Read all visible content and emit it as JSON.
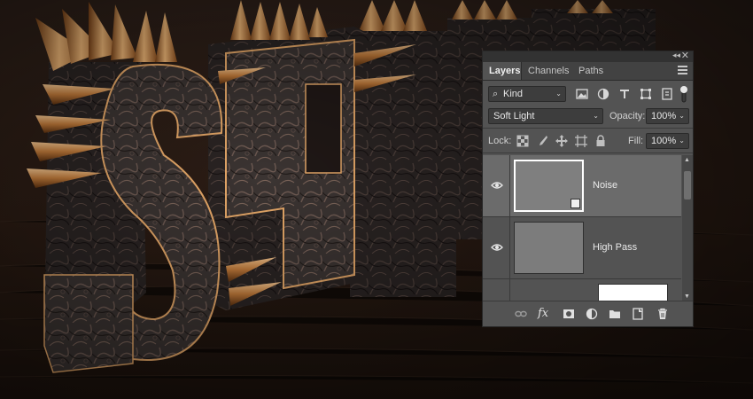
{
  "panel": {
    "tabs": [
      {
        "label": "Layers",
        "active": true
      },
      {
        "label": "Channels",
        "active": false
      },
      {
        "label": "Paths",
        "active": false
      }
    ],
    "collapse_glyph": "◂◂",
    "close_glyph": "✕",
    "filter": {
      "kind_label": "Kind",
      "icons": [
        "image-filter-icon",
        "adjustment-filter-icon",
        "type-filter-icon",
        "shape-filter-icon",
        "smart-object-filter-icon",
        "filter-toggle-icon"
      ]
    },
    "blend_mode": "Soft Light",
    "opacity_label": "Opacity:",
    "opacity_value": "100%",
    "lock_label": "Lock:",
    "lock_icons": [
      "lock-transparent-pixels-icon",
      "lock-image-pixels-icon",
      "lock-position-icon",
      "lock-artboard-icon",
      "lock-all-icon"
    ],
    "fill_label": "Fill:",
    "fill_value": "100%",
    "layers": [
      {
        "name": "Noise",
        "selected": true,
        "visible": true,
        "smart_object": true
      },
      {
        "name": "High Pass",
        "selected": false,
        "visible": true,
        "smart_object": false
      }
    ],
    "bottom_icons": [
      "link-layers-icon",
      "fx-icon",
      "add-mask-icon",
      "adjustment-layer-icon",
      "new-group-icon",
      "new-layer-icon",
      "delete-layer-icon"
    ],
    "fx_label": "fx"
  },
  "colors": {
    "panel_bg": "#535353",
    "tab_bar_bg": "#424242",
    "selected_layer_bg": "#6b6b6b",
    "copper": "#c98a4a",
    "wood_dark": "#241710"
  }
}
